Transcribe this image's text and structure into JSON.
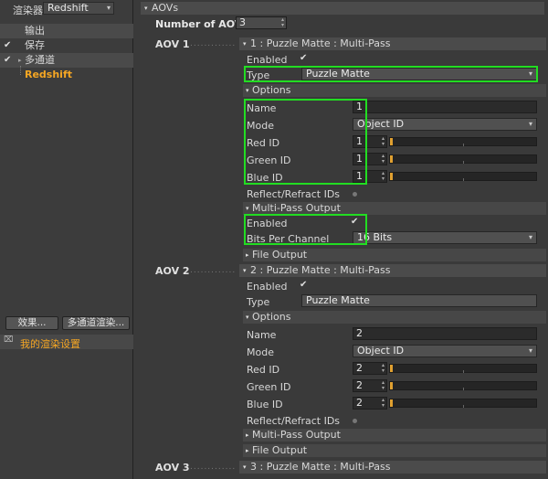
{
  "left": {
    "renderer_label": "渲染器",
    "renderer_value": "Redshift",
    "tree": [
      {
        "label": "输出",
        "checked": false
      },
      {
        "label": "保存",
        "checked": true
      },
      {
        "label": "多通道",
        "checked": true
      },
      {
        "label": "Redshift",
        "checked": false
      }
    ],
    "buttons": {
      "effects": "效果...",
      "multipass_render": "多通道渲染..."
    },
    "settings_label": "我的渲染设置"
  },
  "right": {
    "aovs_header": "AOVs",
    "num_aovs_label": "Number of AOVs",
    "num_aovs_value": "3",
    "aov1": {
      "title": "AOV 1",
      "header": "1 : Puzzle Matte : Multi-Pass",
      "enabled_label": "Enabled",
      "type_label": "Type",
      "type_value": "Puzzle Matte",
      "options_label": "Options",
      "name_label": "Name",
      "name_value": "1",
      "mode_label": "Mode",
      "mode_value": "Object ID",
      "red_label": "Red ID",
      "red_value": "1",
      "green_label": "Green ID",
      "green_value": "1",
      "blue_label": "Blue ID",
      "blue_value": "1",
      "reflect_label": "Reflect/Refract IDs",
      "mpo_label": "Multi-Pass Output",
      "mpo_enabled_label": "Enabled",
      "bits_label": "Bits Per Channel",
      "bits_value": "16 Bits",
      "file_output_label": "File Output"
    },
    "aov2": {
      "title": "AOV 2",
      "header": "2 : Puzzle Matte : Multi-Pass",
      "enabled_label": "Enabled",
      "type_label": "Type",
      "type_value": "Puzzle Matte",
      "options_label": "Options",
      "name_label": "Name",
      "name_value": "2",
      "mode_label": "Mode",
      "mode_value": "Object ID",
      "red_label": "Red ID",
      "red_value": "2",
      "green_label": "Green ID",
      "green_value": "2",
      "blue_label": "Blue ID",
      "blue_value": "2",
      "reflect_label": "Reflect/Refract IDs",
      "mpo_label": "Multi-Pass Output",
      "file_output_label": "File Output"
    },
    "aov3": {
      "title": "AOV 3",
      "header": "3 : Puzzle Matte : Multi-Pass"
    }
  },
  "colors": {
    "accent": "#f5a623",
    "highlight": "#22dd22",
    "slider": "#e0a030"
  }
}
